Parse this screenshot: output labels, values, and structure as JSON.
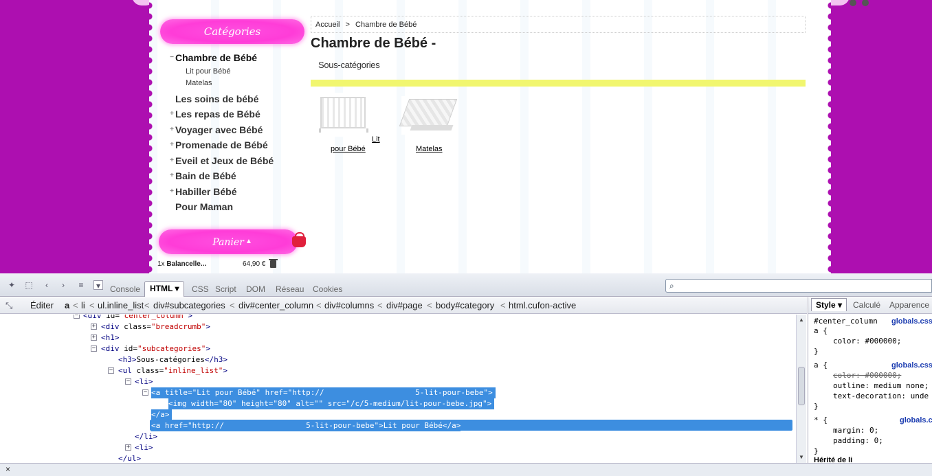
{
  "site": {
    "categories_heading": "Catégories",
    "categories": [
      {
        "label": "Chambre de Bébé",
        "mark": "−",
        "active": true,
        "children": [
          "Lit pour Bébé",
          "Matelas"
        ]
      },
      {
        "label": "Les soins de bébé",
        "mark": ""
      },
      {
        "label": "Les repas de Bébé",
        "mark": "+"
      },
      {
        "label": "Voyager avec Bébé",
        "mark": "+"
      },
      {
        "label": "Promenade de Bébé",
        "mark": "+"
      },
      {
        "label": "Eveil et Jeux de Bébé",
        "mark": "+"
      },
      {
        "label": "Bain de Bébé",
        "mark": "+"
      },
      {
        "label": "Habiller Bébé",
        "mark": "+"
      },
      {
        "label": "Pour Maman",
        "mark": ""
      }
    ],
    "cart_heading": "Panier",
    "cart_item": {
      "qty": "1x",
      "name": "Balancelle...",
      "price": "64,90 €"
    },
    "breadcrumb": {
      "home": "Accueil",
      "sep": ">",
      "current": "Chambre de Bébé"
    },
    "title": "Chambre de Bébé -",
    "subcategories_title": "Sous-catégories",
    "products": [
      {
        "line1": "Lit",
        "line2": "pour Bébé"
      },
      {
        "line1": "Matelas"
      }
    ]
  },
  "firebug": {
    "tabs": [
      "Console",
      "HTML",
      "CSS",
      "Script",
      "DOM",
      "Réseau",
      "Cookies"
    ],
    "active_tab": "HTML",
    "search_placeholder": "",
    "edit_label": "Éditer",
    "crumbs": [
      "a",
      "li",
      "ul.inline_list",
      "div#subcategories",
      "div#center_column",
      "div#columns",
      "div#page",
      "body#category",
      "html.cufon-active"
    ],
    "crumb_sep": "<",
    "html_lines": [
      {
        "text_tag": "<div ",
        "attr": "id=",
        "val": "\"center_column\"",
        "end": ">"
      },
      {
        "text_tag": "<div ",
        "attr": "class=",
        "val": "\"breadcrumb\"",
        "end": ">"
      },
      {
        "text_tag": "<h1>",
        "attr": "",
        "val": "",
        "end": ""
      },
      {
        "text_tag": "<div ",
        "attr": "id=",
        "val": "\"subcategories\"",
        "end": ">"
      },
      {
        "text_tag": "<h3>",
        "attr": "Sous-catégories",
        "val": "",
        "end": "</h3>"
      },
      {
        "text_tag": "<ul ",
        "attr": "class=",
        "val": "\"inline_list\"",
        "end": ">"
      },
      {
        "text_tag": "<li>",
        "attr": "",
        "val": "",
        "end": ""
      },
      {
        "text_tag": "<a title=\"Lit pour Bébé\" href=\"http://",
        "attr": "",
        "val": "",
        "end": "                    5-lit-pour-bebe\">"
      },
      {
        "text_tag": "<img width=\"80\" height=\"80\" alt=\"\" src=\"/c/5-medium/lit-pour-bebe.jpg\">",
        "attr": "",
        "val": "",
        "end": ""
      },
      {
        "text_tag": "</a>",
        "attr": "",
        "val": "",
        "end": ""
      },
      {
        "text_tag": "<a href=\"http://                  5-lit-pour-bebe\">Lit pour Bébé</a>",
        "attr": "",
        "val": "",
        "end": ""
      },
      {
        "text_tag": "</li>",
        "attr": "",
        "val": "",
        "end": ""
      },
      {
        "text_tag": "<li>",
        "attr": "",
        "val": "",
        "end": ""
      },
      {
        "text_tag": "</ul>",
        "attr": "",
        "val": "",
        "end": ""
      }
    ],
    "side_tabs": [
      "Style",
      "Calculé",
      "Apparence"
    ],
    "css_rules": {
      "r1_selector": "#center_column",
      "r1_sel2": "a {",
      "r1_prop": "color: #000000;",
      "r1_file": "globals.css",
      "close": "}",
      "r2_selector": "a {",
      "r2_file": "globals.css",
      "r2_prop1": "color: #000000;",
      "r2_prop2": "outline: medium none;",
      "r2_prop3": "text-decoration: unde",
      "r3_selector": "* {",
      "r3_file": "globals.c",
      "r3_prop1": "margin: 0;",
      "r3_prop2": "padding: 0;",
      "inherited": "Hérité de li"
    },
    "close_label": "×"
  }
}
